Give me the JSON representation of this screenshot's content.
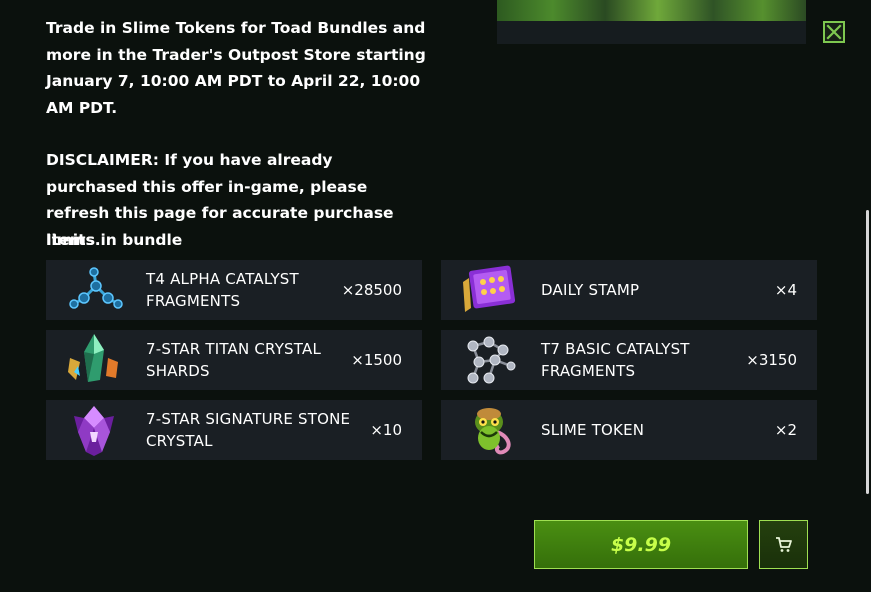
{
  "description": {
    "paragraph1": "Trade in Slime Tokens for Toad Bundles and more in the Trader's Outpost Store starting January 7, 10:00 AM PDT to April 22, 10:00 AM PDT.",
    "paragraph2": "DISCLAIMER: If you have already purchased this offer in-game, please refresh this page for accurate purchase limits."
  },
  "bundle": {
    "title": "Items in bundle",
    "items": [
      {
        "name": "T4 ALPHA CATALYST FRAGMENTS",
        "qty": "×28500",
        "icon": "alpha-catalyst-icon"
      },
      {
        "name": "DAILY STAMP",
        "qty": "×4",
        "icon": "daily-stamp-icon"
      },
      {
        "name": "7-STAR TITAN CRYSTAL SHARDS",
        "qty": "×1500",
        "icon": "titan-crystal-icon"
      },
      {
        "name": "T7 BASIC CATALYST FRAGMENTS",
        "qty": "×3150",
        "icon": "basic-catalyst-icon"
      },
      {
        "name": "7-STAR SIGNATURE STONE CRYSTAL",
        "qty": "×10",
        "icon": "signature-stone-icon"
      },
      {
        "name": "SLIME TOKEN",
        "qty": "×2",
        "icon": "slime-token-icon"
      }
    ]
  },
  "purchase": {
    "price": "$9.99"
  },
  "colors": {
    "accent": "#9fe052",
    "price_text": "#c7ff4a",
    "panel": "#1a1f24",
    "background": "#0b110d"
  }
}
